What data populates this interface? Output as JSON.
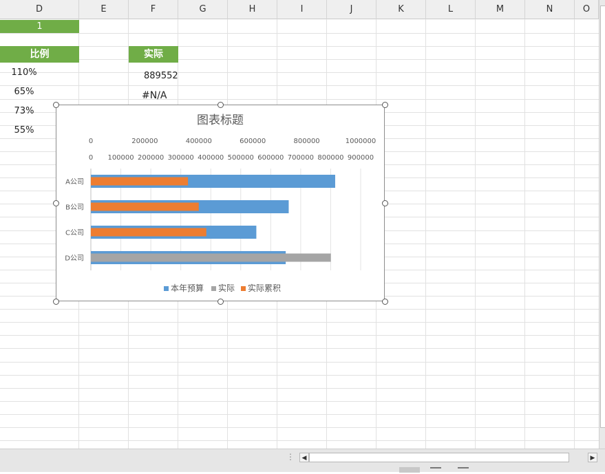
{
  "columns": [
    "D",
    "E",
    "F",
    "G",
    "H",
    "I",
    "J",
    "K",
    "L",
    "M",
    "N",
    "O"
  ],
  "cells": {
    "d_value_1": "1",
    "d_header": "比例",
    "f_header": "实际",
    "d_rows": [
      "110%",
      "65%",
      "73%",
      "55%"
    ],
    "f_rows": [
      "889552",
      "#N/A"
    ]
  },
  "colors": {
    "header_green": "#70ad47",
    "budget_blue": "#5b9bd5",
    "actual_gray": "#a5a5a5",
    "cumulative_orange": "#ed7d31"
  },
  "chart_data": {
    "type": "bar",
    "title": "图表标题",
    "categories": [
      "A公司",
      "B公司",
      "C公司",
      "D公司"
    ],
    "series": [
      {
        "name": "本年预算",
        "axis": "primary",
        "values": [
          815000,
          660000,
          552000,
          650000
        ]
      },
      {
        "name": "实际",
        "axis": "secondary",
        "values": [
          null,
          null,
          null,
          889552
        ]
      },
      {
        "name": "实际累积",
        "axis": "secondary",
        "values": [
          360000,
          400000,
          428000,
          null
        ]
      }
    ],
    "primary_axis": {
      "range": [
        0,
        900000
      ],
      "ticks": [
        0,
        100000,
        200000,
        300000,
        400000,
        500000,
        600000,
        700000,
        800000,
        900000
      ]
    },
    "secondary_axis": {
      "range": [
        0,
        1000000
      ],
      "ticks": [
        0,
        200000,
        400000,
        600000,
        800000,
        1000000
      ]
    },
    "legend": "bottom",
    "grid": true
  }
}
